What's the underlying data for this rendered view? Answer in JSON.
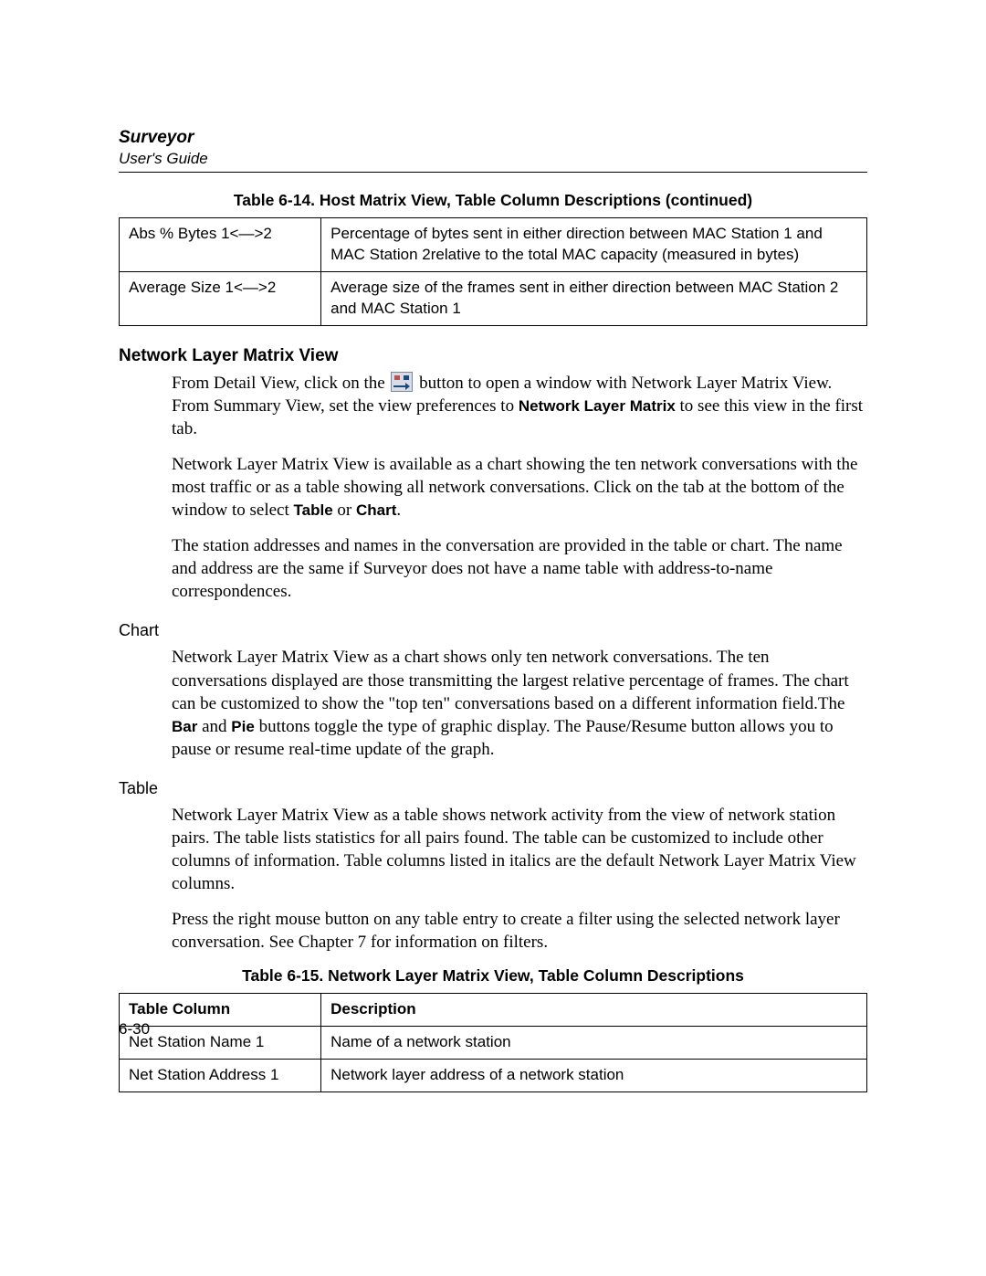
{
  "header": {
    "title": "Surveyor",
    "subtitle": "User's Guide"
  },
  "table14": {
    "caption": "Table 6-14. Host Matrix View, Table Column Descriptions (continued)",
    "rows": [
      {
        "col": "Abs % Bytes 1<—>2",
        "desc": "Percentage of bytes sent in either direction between MAC Station 1 and MAC Station 2relative to the total MAC capacity (measured in bytes)"
      },
      {
        "col": "Average Size 1<—>2",
        "desc": "Average size of the frames sent in either direction between MAC Station 2 and MAC Station 1"
      }
    ]
  },
  "sections": {
    "nlmv_heading": "Network Layer Matrix View",
    "para1a": "From Detail View, click on the ",
    "para1b": " button to open a window with Network Layer Matrix View. From Summary View, set the view preferences to ",
    "para1_bold1": "Network Layer Matrix",
    "para1c": " to see this view in the first tab.",
    "para2a": "Network Layer Matrix View is available as a chart showing the ten network conversations with the most traffic or as a table showing all network conversations. Click on the tab at the bottom of the window to select ",
    "para2_bold1": "Table",
    "para2b": " or ",
    "para2_bold2": "Chart",
    "para2c": ".",
    "para3": "The station addresses and names in the conversation are provided in the table or chart. The name and address are the same if Surveyor does not have a name table with address-to-name correspondences.",
    "chart_heading": "Chart",
    "chart_para_a": "Network Layer Matrix View as a chart shows only ten network conversations. The ten conversations displayed are those transmitting the largest relative percentage of frames. The chart can be customized to show the \"top ten\" conversations based on a different information field.The ",
    "chart_bold1": "Bar",
    "chart_para_b": " and ",
    "chart_bold2": "Pie",
    "chart_para_c": " buttons toggle the type of graphic display. The Pause/Resume button allows you to pause or resume real-time update of the graph.",
    "table_heading": "Table",
    "table_para1": "Network Layer Matrix View as a table shows network activity from the view of network station pairs. The table lists statistics for all pairs found. The table can be customized to include other columns of information. Table columns listed in italics are the default Network Layer Matrix View columns.",
    "table_para2": "Press the right mouse button on any table entry to create a filter using the selected network layer conversation. See Chapter 7 for information on filters."
  },
  "table15": {
    "caption": "Table 6-15. Network Layer Matrix View, Table Column Descriptions",
    "header": {
      "c1": "Table Column",
      "c2": "Description"
    },
    "rows": [
      {
        "col": "Net Station Name 1",
        "desc": "Name of a network station"
      },
      {
        "col": "Net Station Address 1",
        "desc": "Network layer address of a network station"
      }
    ]
  },
  "page_number": "6-30"
}
